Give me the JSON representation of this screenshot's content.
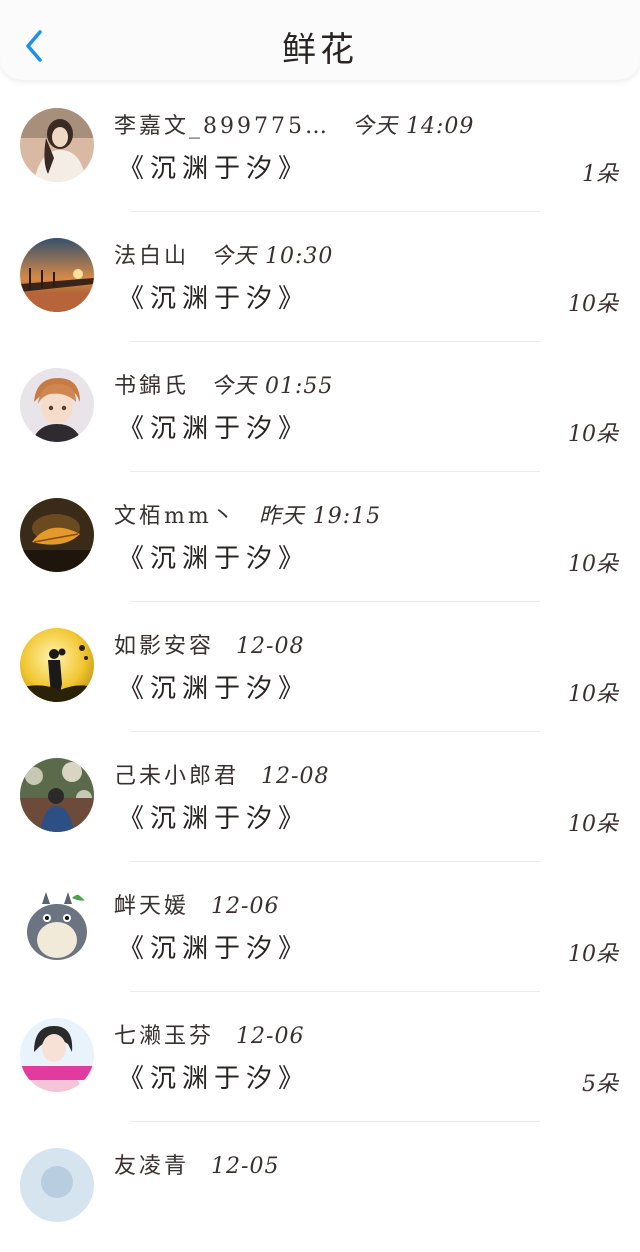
{
  "header": {
    "title": "鲜花",
    "back_icon": "chevron-left-icon",
    "accent_color": "#1e90e8"
  },
  "entries": [
    {
      "name": "李嘉文_899775…",
      "time": "今天 14:09",
      "book": "《沉渊于汐》",
      "count": "1朵",
      "avatar_icon": "avatar-girl-icon"
    },
    {
      "name": "法白山",
      "time": "今天 10:30",
      "book": "《沉渊于汐》",
      "count": "10朵",
      "avatar_icon": "avatar-sunset-pier-icon"
    },
    {
      "name": "书錦氏",
      "time": "今天 01:55",
      "book": "《沉渊于汐》",
      "count": "10朵",
      "avatar_icon": "avatar-anime-boy-icon"
    },
    {
      "name": "文栢mm丶",
      "time": "昨天 19:15",
      "book": "《沉渊于汐》",
      "count": "10朵",
      "avatar_icon": "avatar-autumn-leaf-icon"
    },
    {
      "name": "如影安容",
      "time": "12-08",
      "book": "《沉渊于汐》",
      "count": "10朵",
      "avatar_icon": "avatar-silhouette-icon"
    },
    {
      "name": "己未小郎君",
      "time": "12-08",
      "book": "《沉渊于汐》",
      "count": "10朵",
      "avatar_icon": "avatar-person-wall-icon"
    },
    {
      "name": "衅天媛",
      "time": "12-06",
      "book": "《沉渊于汐》",
      "count": "10朵",
      "avatar_icon": "avatar-totoro-icon"
    },
    {
      "name": "七濑玉芬",
      "time": "12-06",
      "book": "《沉渊于汐》",
      "count": "5朵",
      "avatar_icon": "avatar-girl-banner-icon"
    },
    {
      "name": "友凌青",
      "time": "12-05",
      "book": "",
      "count": "",
      "avatar_icon": "avatar-partial-icon"
    }
  ]
}
